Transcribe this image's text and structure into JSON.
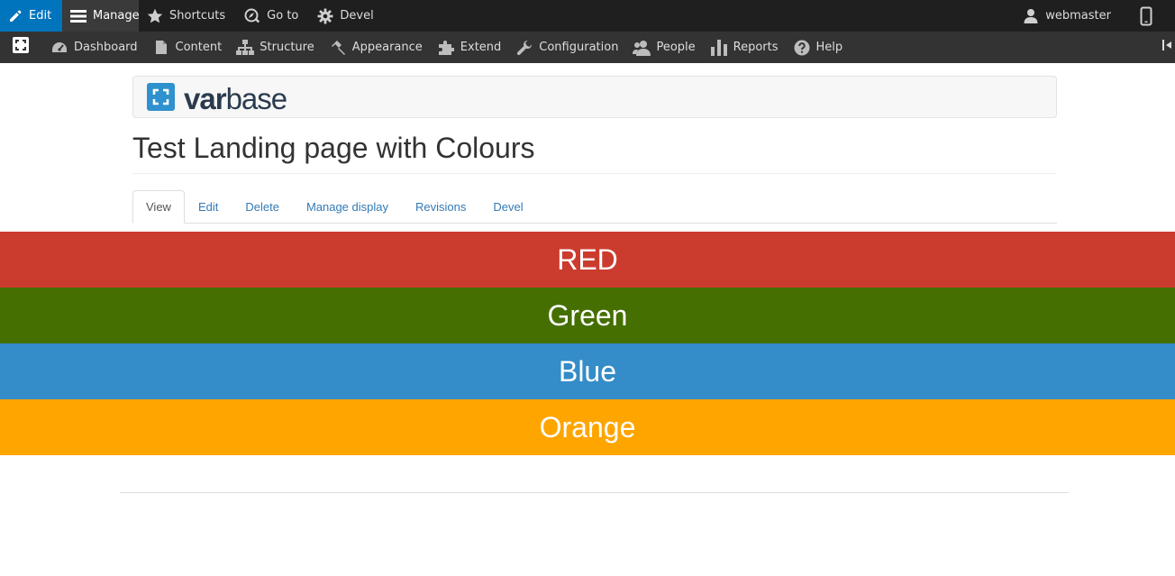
{
  "toolbar": {
    "edit_label": "Edit",
    "manage_label": "Manage",
    "shortcuts_label": "Shortcuts",
    "goto_label": "Go to",
    "devel_label": "Devel",
    "user_label": "webmaster"
  },
  "admin_menu": {
    "items": [
      {
        "label": "Dashboard",
        "icon": "dashboard-icon"
      },
      {
        "label": "Content",
        "icon": "file-icon"
      },
      {
        "label": "Structure",
        "icon": "sitemap-icon"
      },
      {
        "label": "Appearance",
        "icon": "paintbrush-icon"
      },
      {
        "label": "Extend",
        "icon": "puzzle-icon"
      },
      {
        "label": "Configuration",
        "icon": "wrench-icon"
      },
      {
        "label": "People",
        "icon": "people-icon"
      },
      {
        "label": "Reports",
        "icon": "bar-chart-icon"
      },
      {
        "label": "Help",
        "icon": "help-icon"
      }
    ]
  },
  "header": {
    "logo_bold": "var",
    "logo_light": "base"
  },
  "page": {
    "title": "Test Landing page with Colours"
  },
  "tabs": [
    {
      "label": "View",
      "active": true
    },
    {
      "label": "Edit",
      "active": false
    },
    {
      "label": "Delete",
      "active": false
    },
    {
      "label": "Manage display",
      "active": false
    },
    {
      "label": "Revisions",
      "active": false
    },
    {
      "label": "Devel",
      "active": false
    }
  ],
  "bands": [
    {
      "label": "RED",
      "color": "#cb3b2e"
    },
    {
      "label": "Green",
      "color": "#456f00"
    },
    {
      "label": "Blue",
      "color": "#348cc8"
    },
    {
      "label": "Orange",
      "color": "#fea500"
    }
  ],
  "colors": {
    "accent": "#0074bd",
    "link": "#337ab7",
    "toolbar_dark": "#1f1f1f",
    "toolbar_tray": "#333333",
    "logo_blue": "#2f91cd"
  }
}
